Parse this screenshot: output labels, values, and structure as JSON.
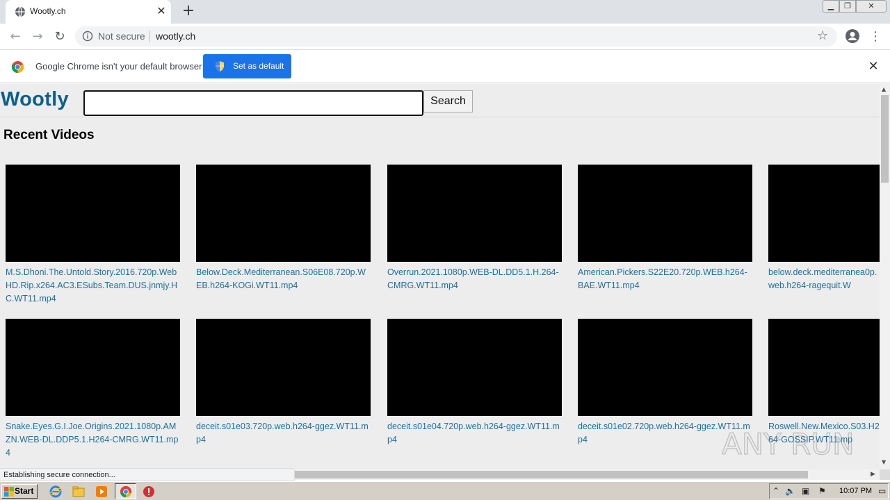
{
  "browser": {
    "tab_title": "Wootly.ch",
    "new_tab": "+",
    "tab_close": "✕",
    "security_label": "Not secure",
    "url": "wootly.ch",
    "infobar_message": "Google Chrome isn't your default browser",
    "set_default_label": "Set as default",
    "status_text": "Establishing secure connection..."
  },
  "page": {
    "logo": "Wootly",
    "search_placeholder": "",
    "search_button": "Search",
    "section_title": "Recent Videos",
    "videos": [
      {
        "title": "M.S.Dhoni.The.Untold.Story.2016.720p.WebHD.Rip.x264.AC3.ESubs.Team.DUS.jnmjy.HC.WT11.mp4"
      },
      {
        "title": "Below.Deck.Mediterranean.S06E08.720p.WEB.h264-KOGi.WT11.mp4"
      },
      {
        "title": "Overrun.2021.1080p.WEB-DL.DD5.1.H.264-CMRG.WT11.mp4"
      },
      {
        "title": "American.Pickers.S22E20.720p.WEB.h264-BAE.WT11.mp4"
      },
      {
        "title": "below.deck.mediterranea0p.web.h264-ragequit.W"
      },
      {
        "title": "Snake.Eyes.G.I.Joe.Origins.2021.1080p.AMZN.WEB-DL.DDP5.1.H264-CMRG.WT11.mp4"
      },
      {
        "title": "deceit.s01e03.720p.web.h264-ggez.WT11.mp4"
      },
      {
        "title": "deceit.s01e04.720p.web.h264-ggez.WT11.mp4"
      },
      {
        "title": "deceit.s01e02.720p.web.h264-ggez.WT11.mp4"
      },
      {
        "title": "Roswell.New.Mexico.S03.H264-GOSSIP.WT11.mp"
      }
    ]
  },
  "taskbar": {
    "start_label": "Start",
    "clock": "10:07 PM"
  },
  "watermark_text": "ANY RUN",
  "colors": {
    "logo": "#0d5f88",
    "link": "#1d6fa0",
    "infobar_button": "#1a73e8",
    "page_background": "#ededed"
  }
}
